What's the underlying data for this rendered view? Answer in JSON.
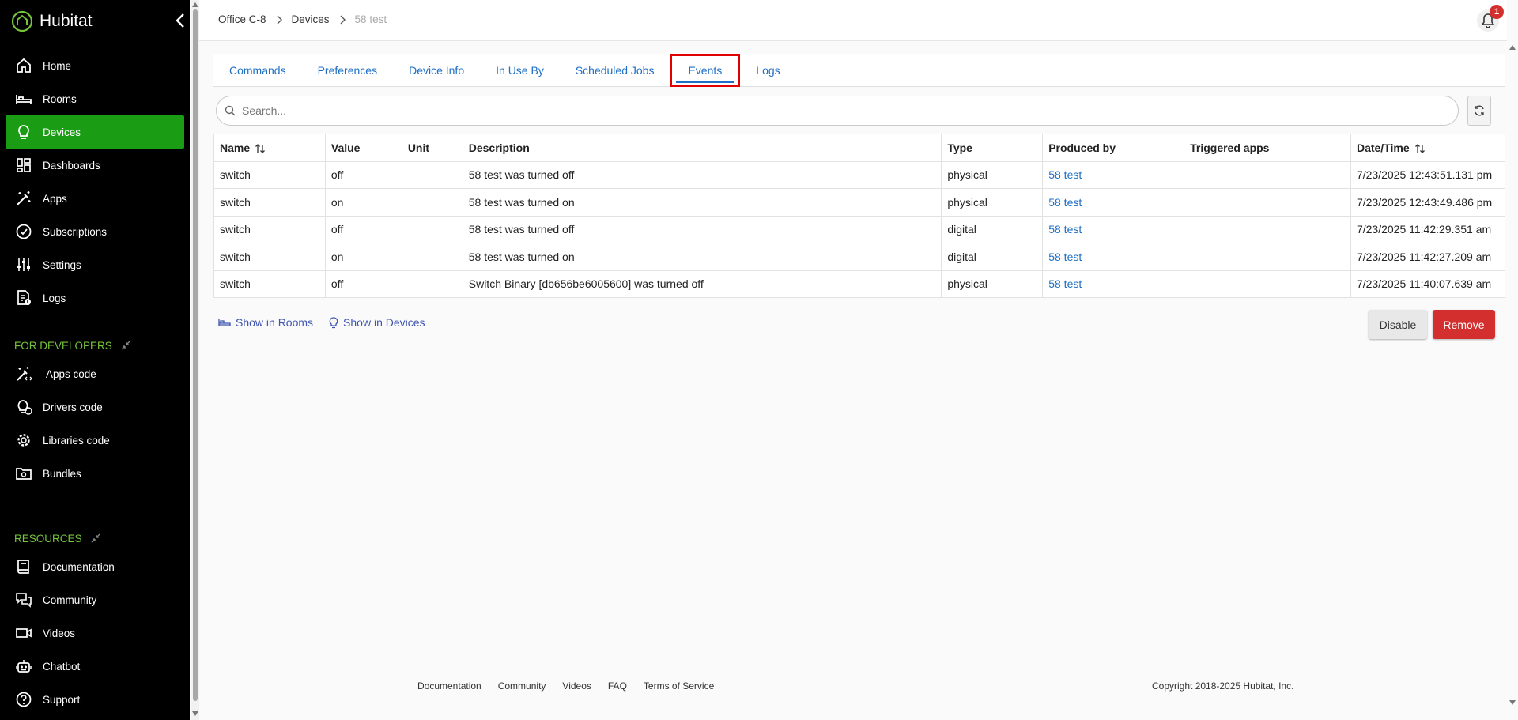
{
  "app": {
    "name": "Hubitat"
  },
  "sidebar": {
    "items": [
      {
        "label": "Home",
        "icon": "home-icon"
      },
      {
        "label": "Rooms",
        "icon": "bed-icon"
      },
      {
        "label": "Devices",
        "icon": "bulb-icon",
        "active": true
      },
      {
        "label": "Dashboards",
        "icon": "dashboard-icon"
      },
      {
        "label": "Apps",
        "icon": "magic-wand-icon"
      },
      {
        "label": "Subscriptions",
        "icon": "check-circle-icon"
      },
      {
        "label": "Settings",
        "icon": "sliders-icon"
      },
      {
        "label": "Logs",
        "icon": "log-file-icon"
      }
    ],
    "dev_section": "FOR DEVELOPERS",
    "dev_items": [
      {
        "label": "Apps code",
        "icon": "wand-code-icon"
      },
      {
        "label": "Drivers code",
        "icon": "bulb-code-icon"
      },
      {
        "label": "Libraries code",
        "icon": "gear-code-icon"
      },
      {
        "label": "Bundles",
        "icon": "folder-bundle-icon"
      }
    ],
    "res_section": "RESOURCES",
    "res_items": [
      {
        "label": "Documentation",
        "icon": "book-icon"
      },
      {
        "label": "Community",
        "icon": "chat-icon"
      },
      {
        "label": "Videos",
        "icon": "video-icon"
      },
      {
        "label": "Chatbot",
        "icon": "robot-icon"
      },
      {
        "label": "Support",
        "icon": "help-icon"
      }
    ]
  },
  "breadcrumb": {
    "hub": "Office C-8",
    "section": "Devices",
    "device": "58 test"
  },
  "notifications": {
    "count": "1"
  },
  "tabs": [
    {
      "label": "Commands"
    },
    {
      "label": "Preferences"
    },
    {
      "label": "Device Info"
    },
    {
      "label": "In Use By"
    },
    {
      "label": "Scheduled Jobs"
    },
    {
      "label": "Events",
      "active": true
    },
    {
      "label": "Logs"
    }
  ],
  "search": {
    "placeholder": "Search..."
  },
  "table": {
    "headers": {
      "name": "Name",
      "value": "Value",
      "unit": "Unit",
      "description": "Description",
      "type": "Type",
      "produced_by": "Produced by",
      "triggered_apps": "Triggered apps",
      "datetime": "Date/Time"
    },
    "rows": [
      {
        "name": "switch",
        "value": "off",
        "unit": "",
        "description": "58 test was turned off",
        "type": "physical",
        "produced_by": "58 test",
        "triggered_apps": "",
        "datetime": "7/23/2025 12:43:51.131 pm"
      },
      {
        "name": "switch",
        "value": "on",
        "unit": "",
        "description": "58 test was turned on",
        "type": "physical",
        "produced_by": "58 test",
        "triggered_apps": "",
        "datetime": "7/23/2025 12:43:49.486 pm"
      },
      {
        "name": "switch",
        "value": "off",
        "unit": "",
        "description": "58 test was turned off",
        "type": "digital",
        "produced_by": "58 test",
        "triggered_apps": "",
        "datetime": "7/23/2025 11:42:29.351 am"
      },
      {
        "name": "switch",
        "value": "on",
        "unit": "",
        "description": "58 test was turned on",
        "type": "digital",
        "produced_by": "58 test",
        "triggered_apps": "",
        "datetime": "7/23/2025 11:42:27.209 am"
      },
      {
        "name": "switch",
        "value": "off",
        "unit": "",
        "description": "Switch Binary [db656be6005600] was turned off",
        "type": "physical",
        "produced_by": "58 test",
        "triggered_apps": "",
        "datetime": "7/23/2025 11:40:07.639 am"
      }
    ]
  },
  "actions": {
    "show_rooms": "Show in Rooms",
    "show_devices": "Show in Devices",
    "disable": "Disable",
    "remove": "Remove"
  },
  "footer": {
    "links": [
      "Documentation",
      "Community",
      "Videos",
      "FAQ",
      "Terms of Service"
    ],
    "copyright": "Copyright 2018-2025 Hubitat, Inc."
  },
  "colors": {
    "sidebar_bg": "#000000",
    "active_nav": "#1a9c14",
    "section_label": "#75c33a",
    "link": "#1e6fc5",
    "remove": "#d32f2f",
    "highlight": "#e00000"
  }
}
